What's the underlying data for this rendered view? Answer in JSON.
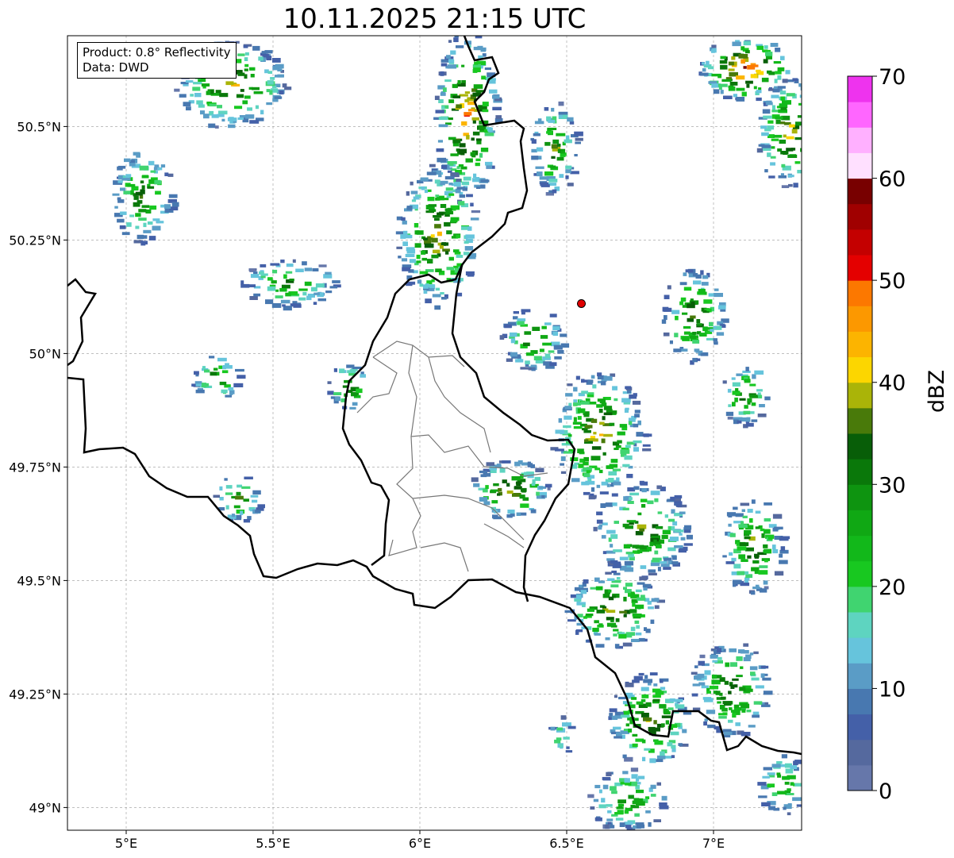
{
  "title": "10.11.2025 21:15 UTC",
  "info": {
    "product": "Product: 0.8° Reflectivity",
    "data": "Data: DWD"
  },
  "map": {
    "extent_lon": [
      4.8,
      7.3
    ],
    "extent_lat": [
      48.95,
      50.7
    ],
    "lon_ticks": [
      {
        "value": 5.0,
        "label": "5°E"
      },
      {
        "value": 5.5,
        "label": "5.5°E"
      },
      {
        "value": 6.0,
        "label": "6°E"
      },
      {
        "value": 6.5,
        "label": "6.5°E"
      },
      {
        "value": 7.0,
        "label": "7°E"
      }
    ],
    "lat_ticks": [
      {
        "value": 49.0,
        "label": "49°N"
      },
      {
        "value": 49.25,
        "label": "49.25°N"
      },
      {
        "value": 49.5,
        "label": "49.5°N"
      },
      {
        "value": 49.75,
        "label": "49.75°N"
      },
      {
        "value": 50.0,
        "label": "50°N"
      },
      {
        "value": 50.25,
        "label": "50.25°N"
      },
      {
        "value": 50.5,
        "label": "50.5°N"
      }
    ],
    "radar_site": {
      "lon": 6.55,
      "lat": 50.11,
      "color": "#e00000"
    },
    "gridlines": true
  },
  "colorbar": {
    "label": "dBZ",
    "range": [
      0,
      70
    ],
    "ticks": [
      {
        "value": 0,
        "label": "0"
      },
      {
        "value": 10,
        "label": "10"
      },
      {
        "value": 20,
        "label": "20"
      },
      {
        "value": 30,
        "label": "30"
      },
      {
        "value": 40,
        "label": "40"
      },
      {
        "value": 50,
        "label": "50"
      },
      {
        "value": 60,
        "label": "60"
      },
      {
        "value": 70,
        "label": "70"
      }
    ],
    "colors": [
      "#6677aa",
      "#55699e",
      "#4460a8",
      "#4878b0",
      "#5a9cc6",
      "#66c4dc",
      "#5ed4c0",
      "#40d470",
      "#18c820",
      "#12b81a",
      "#10a814",
      "#0e9410",
      "#0a780a",
      "#085e08",
      "#497a0a",
      "#aab408",
      "#fcd600",
      "#fcb400",
      "#fc9800",
      "#fc7800",
      "#e40000",
      "#c40000",
      "#a00000",
      "#780000",
      "#ffe0ff",
      "#ffb0ff",
      "#ff66ff",
      "#ee33ee"
    ]
  }
}
